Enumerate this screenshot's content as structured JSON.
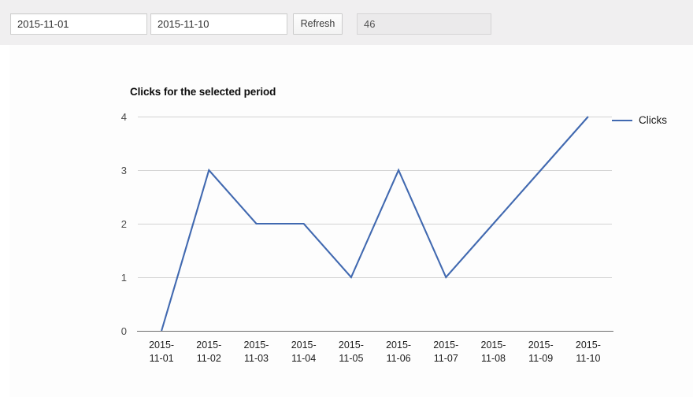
{
  "toolbar": {
    "date_from": {
      "value": "2015-11-01",
      "placeholder": "yyyy-mm-dd"
    },
    "date_to": {
      "value": "2015-11-10",
      "placeholder": "yyyy-mm-dd"
    },
    "refresh_label": "Refresh",
    "total_count": {
      "value": "46",
      "placeholder": ""
    }
  },
  "legend": {
    "position": "right",
    "items": [
      {
        "label": "Clicks",
        "color": "#4169b0"
      }
    ]
  },
  "colors": {
    "series_blue": "#4169b0",
    "header_band": "#f0eff0",
    "card_background": "#fdfdfd",
    "gridline": "#d3d3d3",
    "axis": "#6b6b6b"
  },
  "chart_data": {
    "type": "line",
    "title": "Clicks for the selected period",
    "xlabel": "",
    "ylabel": "",
    "categories": [
      "2015-11-01",
      "2015-11-02",
      "2015-11-03",
      "2015-11-04",
      "2015-11-05",
      "2015-11-06",
      "2015-11-07",
      "2015-11-08",
      "2015-11-09",
      "2015-11-10"
    ],
    "category_lines": [
      [
        "2015-",
        "11-01"
      ],
      [
        "2015-",
        "11-02"
      ],
      [
        "2015-",
        "11-03"
      ],
      [
        "2015-",
        "11-04"
      ],
      [
        "2015-",
        "11-05"
      ],
      [
        "2015-",
        "11-06"
      ],
      [
        "2015-",
        "11-07"
      ],
      [
        "2015-",
        "11-08"
      ],
      [
        "2015-",
        "11-09"
      ],
      [
        "2015-",
        "11-10"
      ]
    ],
    "series": [
      {
        "name": "Clicks",
        "color": "#4169b0",
        "values": [
          0,
          3,
          2,
          2,
          1,
          3,
          1,
          2,
          3,
          4
        ]
      }
    ],
    "ylim": [
      0,
      4
    ],
    "yticks": [
      0,
      1,
      2,
      3,
      4
    ],
    "ytick_labels": [
      "0",
      "1",
      "2",
      "3",
      "4"
    ],
    "grid": true,
    "legend_position": "right"
  }
}
